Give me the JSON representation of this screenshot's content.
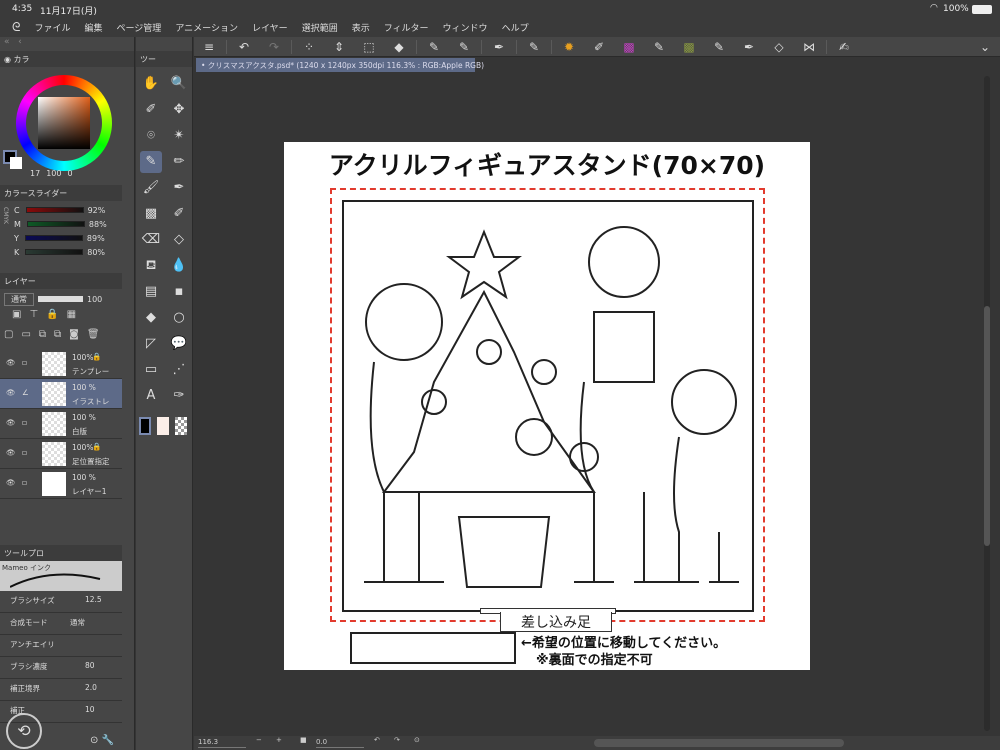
{
  "status": {
    "time": "4:35",
    "date": "11月17日(月)",
    "battery": "100%"
  },
  "menu": [
    "ファイル",
    "編集",
    "ページ管理",
    "アニメーション",
    "レイヤー",
    "選択範囲",
    "表示",
    "フィルター",
    "ウィンドウ",
    "ヘルプ"
  ],
  "color_panel": {
    "tab": "カラ",
    "values": [
      "17",
      "100",
      "0"
    ]
  },
  "color_slider": {
    "title": "カラースライダー",
    "mode": "CMYK",
    "rows": [
      {
        "label": "C",
        "value": "92%",
        "color": "#8b0a0a"
      },
      {
        "label": "M",
        "value": "88%",
        "color": "#0d5a26"
      },
      {
        "label": "Y",
        "value": "89%",
        "color": "#0a0a55"
      },
      {
        "label": "K",
        "value": "80%",
        "color": "#2a3a33"
      }
    ]
  },
  "layer_panel": {
    "tab": "レイヤー",
    "blend": "通常",
    "opacity": "100",
    "layers": [
      {
        "opacity": "100%",
        "name": "テンプレー",
        "locked": true
      },
      {
        "opacity": "100 %",
        "name": "イラストレ",
        "selected": true
      },
      {
        "opacity": "100 %",
        "name": "白版"
      },
      {
        "opacity": "100%",
        "name": "足位置指定",
        "locked": true
      },
      {
        "opacity": "100 %",
        "name": "レイヤー1"
      }
    ]
  },
  "tool_property": {
    "tab": "ツールプロ",
    "brush": "Mameo インク",
    "rows": [
      {
        "label": "ブラシサイズ",
        "value": "12.5"
      },
      {
        "label": "合成モード",
        "value": "通常"
      },
      {
        "label": "アンチエイリ",
        "value": ""
      },
      {
        "label": "ブラシ濃度",
        "value": "80"
      },
      {
        "label": "補正境界",
        "value": "2.0"
      },
      {
        "label": "補正",
        "value": "10"
      }
    ]
  },
  "tool_tab": "ツー",
  "document_tab": "• クリスマスアクスタ.psd* (1240 x 1240px 350dpi 116.3% : RGB:Apple RGB)",
  "page": {
    "title": "アクリルフィギュアスタンド(70×70)",
    "foot_label": "差し込み足",
    "note1": "←希望の位置に移動してください。",
    "note2": "※裏面での指定不可",
    "guide_color": "#e23b2e"
  },
  "bottom": {
    "zoom": "116.3",
    "rotate": "0.0"
  }
}
